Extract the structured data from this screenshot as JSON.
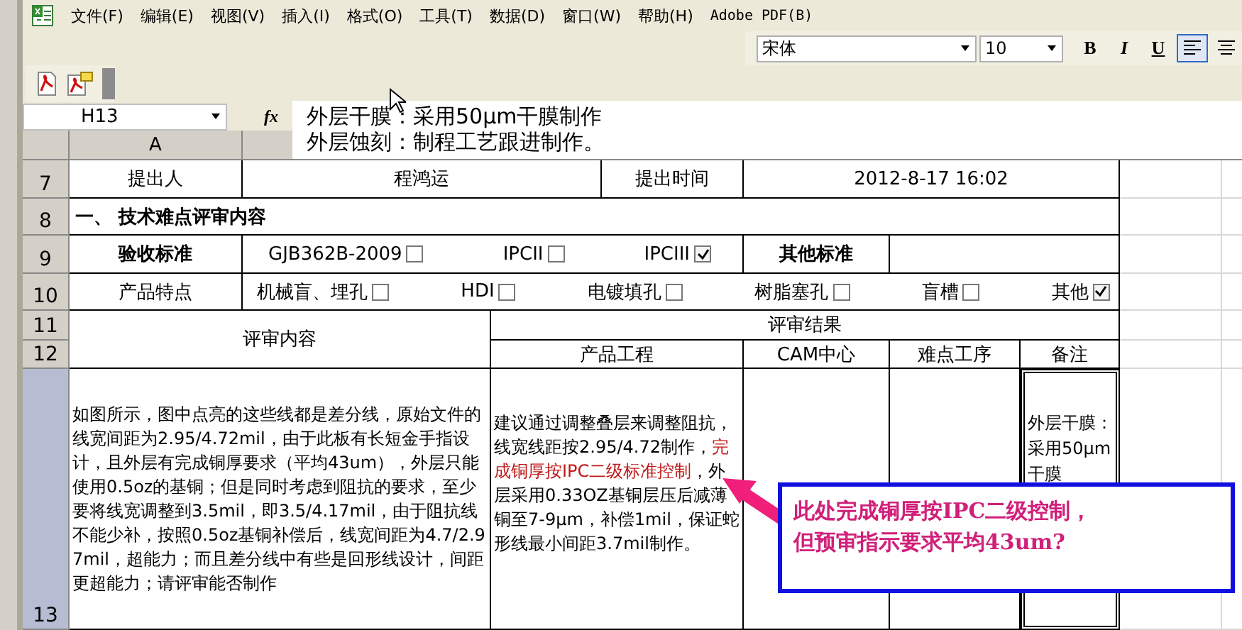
{
  "menu": [
    "文件(F)",
    "编辑(E)",
    "视图(V)",
    "插入(I)",
    "格式(O)",
    "工具(T)",
    "数据(D)",
    "窗口(W)",
    "帮助(H)",
    "Adobe PDF(B)"
  ],
  "format_toolbar": {
    "font": "宋体",
    "size": "10",
    "style_buttons": [
      "B",
      "I",
      "U"
    ],
    "align_buttons": [
      {
        "selected": true
      },
      {
        "selected": false
      }
    ]
  },
  "formula_bar": {
    "name_box": "H13",
    "fx": "fx",
    "lines": [
      "外层干膜：采用50μm干膜制作",
      "外层蚀刻：制程工艺跟进制作。"
    ]
  },
  "column_headers": [
    "A"
  ],
  "row_headers": [
    {
      "label": "7",
      "selected": false
    },
    {
      "label": "8",
      "selected": false
    },
    {
      "label": "9",
      "selected": false
    },
    {
      "label": "10",
      "selected": false
    },
    {
      "label": "11",
      "selected": false
    },
    {
      "label": "12",
      "selected": false
    },
    {
      "label": "13",
      "selected": true
    }
  ],
  "proposer": {
    "label": "提出人",
    "value": "程鸿运",
    "time_label": "提出时间",
    "time_value": "2012-8-17  16:02"
  },
  "section_title": "一、 技术难点评审内容",
  "standards": {
    "label": "验收标准",
    "options": [
      {
        "label": "GJB362B-2009",
        "checked": false
      },
      {
        "label": "IPCII",
        "checked": false
      },
      {
        "label": "IPCIII",
        "checked": true
      }
    ],
    "other_label": "其他标准"
  },
  "features": {
    "label": "产品特点",
    "options": [
      {
        "label": "机械盲、埋孔",
        "checked": false
      },
      {
        "label": "HDI",
        "checked": false
      },
      {
        "label": "电镀填孔",
        "checked": false
      },
      {
        "label": "树脂塞孔",
        "checked": false
      },
      {
        "label": "盲槽",
        "checked": false
      },
      {
        "label": "其他",
        "checked": true
      }
    ]
  },
  "review": {
    "content_header": "评审内容",
    "result_header": "评审结果",
    "result_columns": [
      "产品工程",
      "CAM中心",
      "难点工序",
      "备注"
    ],
    "content": "如图所示，图中点亮的这些线都是差分线，原始文件的线宽间距为2.95/4.72mil，由于此板有长短金手指设计，且外层有完成铜厚要求（平均43um），外层只能使用0.5oz的基铜；但是同时考虑到阻抗的要求，至少要将线宽调整到3.5mil，即3.5/4.17mil，由于阻抗线不能少补，按照0.5oz基铜补偿后，线宽间距为4.7/2.97mil，超能力；而且差分线中有些是回形线设计，间距更超能力；请评审能否制作",
    "engineering": [
      {
        "text": "建议通过调整叠层来调整阻抗，线宽线距按2.95/4.72制作，",
        "highlight": false
      },
      {
        "text": "完成铜厚按IPC二级标准控制",
        "highlight": true
      },
      {
        "text": "，外层采用0.33OZ基铜层压后减薄铜至7-9μm，补偿1mil，保证蛇形线最小间距3.7mil制作。",
        "highlight": false
      }
    ],
    "remark": "外层干膜：采用50μm干膜"
  },
  "callout": {
    "lines": [
      "此处完成铜厚按IPC二级控制，",
      "但预审指示要求平均43um?"
    ]
  }
}
